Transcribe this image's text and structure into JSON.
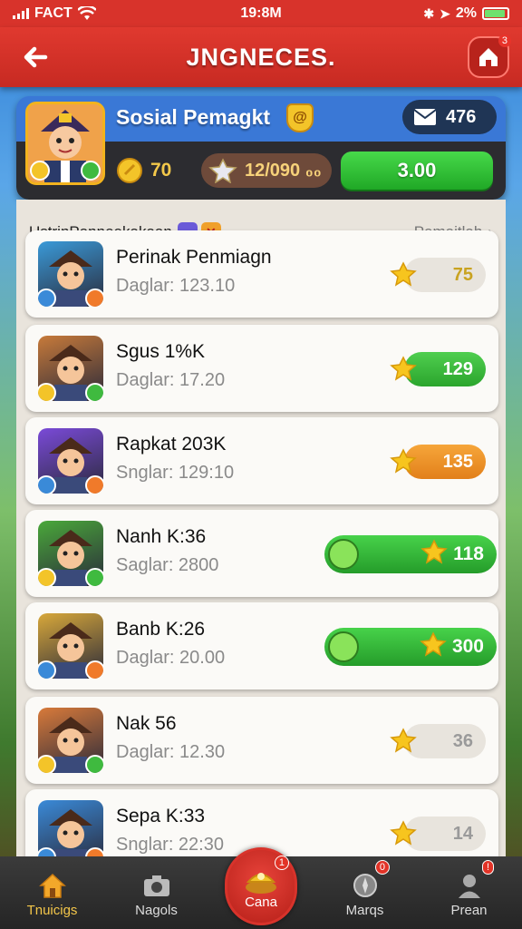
{
  "status_bar": {
    "carrier": "FACT",
    "time": "19:8M",
    "battery": "2%"
  },
  "header": {
    "title": "JNGNECES.",
    "home_badge": "3"
  },
  "profile": {
    "name": "Sosial Pemagkt",
    "rank": "@",
    "messages": "476",
    "coins": "70",
    "gems": "12/090 ₀₀",
    "cash_button": "3.00"
  },
  "list": {
    "title": "UstrinPanneekakaan",
    "link": "Pemaitlah",
    "rows": [
      {
        "name": "Perinak Penmiagn",
        "sub": "Daglar: 123.10",
        "score": "75",
        "style": "gray",
        "avatar_color": "#3a9ad8"
      },
      {
        "name": "Sgus 1%K",
        "sub": "Daglar: 17.20",
        "score": "129",
        "style": "green",
        "avatar_color": "#c77a3a"
      },
      {
        "name": "Rapkat 203K",
        "sub": "Snglar: 129:10",
        "score": "135",
        "style": "orange",
        "avatar_color": "#7a4ad8"
      },
      {
        "name": "Nanh K:36",
        "sub": "Saglar: 2800",
        "score": "118",
        "style": "action",
        "avatar_color": "#4aa83a"
      },
      {
        "name": "Banb K:26",
        "sub": "Daglar: 20.00",
        "score": "300",
        "style": "action",
        "avatar_color": "#d8a83a"
      },
      {
        "name": "Nak 56",
        "sub": "Daglar: 12.30",
        "score": "36",
        "style": "gray2",
        "avatar_color": "#d87a3a"
      },
      {
        "name": "Sepa K:33",
        "sub": "Snglar: 22:30",
        "score": "14",
        "style": "gray2",
        "avatar_color": "#3a8ad8"
      }
    ]
  },
  "nav": {
    "items": [
      {
        "label": "Tnuicigs",
        "icon": "house-icon"
      },
      {
        "label": "Nagols",
        "icon": "camera-icon"
      },
      {
        "label": "Cana",
        "icon": "treasure-icon",
        "badge": "1"
      },
      {
        "label": "Marqs",
        "icon": "compass-icon",
        "badge": "0"
      },
      {
        "label": "Prean",
        "icon": "person-icon",
        "badge": "!"
      }
    ]
  },
  "colors": {
    "header": "#d8332b",
    "accent_green": "#2ba52d",
    "gold": "#f3c429"
  }
}
